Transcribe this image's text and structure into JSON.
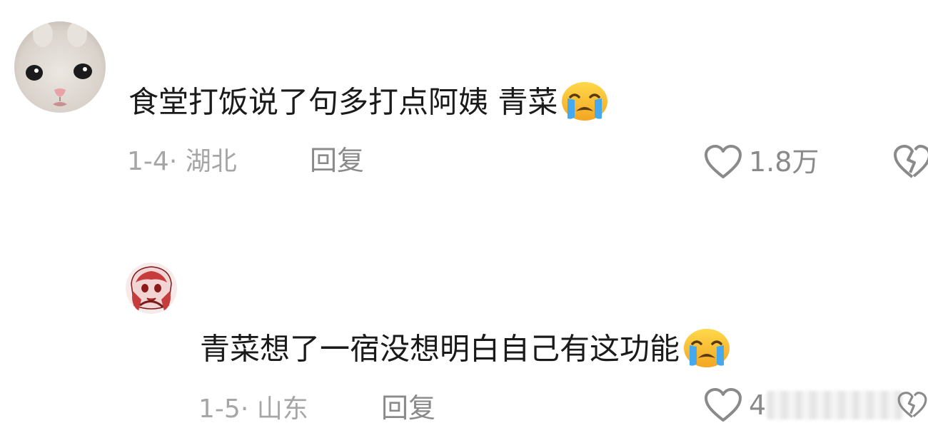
{
  "comments": [
    {
      "avatar": "cat-avatar",
      "text": "食堂打饭说了句多打点阿姨 青菜",
      "emoji": "loudly-crying-emoji",
      "date": "1-4",
      "separator": "·",
      "location": "湖北",
      "reply_label": "回复",
      "like_icon": "heart-outline-icon",
      "like_count": "1.8万",
      "dislike_icon": "broken-heart-icon"
    },
    {
      "avatar": "anime-girl-avatar",
      "text": "青菜想了一宿没想明白自己有这功能",
      "emoji": "loudly-crying-emoji",
      "date": "1-5",
      "separator": "·",
      "location": "山东",
      "reply_label": "回复",
      "like_icon": "heart-outline-icon",
      "like_count": "4",
      "dislike_icon": "broken-heart-icon"
    }
  ],
  "colors": {
    "text": "#1a1a1a",
    "meta": "#a6a6a6",
    "action": "#8a8a8a",
    "background": "#ffffff"
  }
}
